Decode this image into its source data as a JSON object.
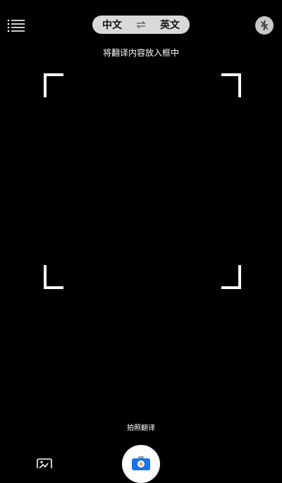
{
  "header": {
    "menu_icon": "list-menu-icon",
    "source_lang": "中文",
    "target_lang": "英文",
    "swap_icon": "swap-arrows-icon",
    "flash_icon": "flash-off-icon"
  },
  "viewfinder": {
    "hint": "将翻译内容放入框中"
  },
  "footer": {
    "mode_label": "拍照翻译",
    "gallery_icon": "image-gallery-icon",
    "shutter_icon": "camera-shutter-icon"
  },
  "colors": {
    "background": "#000000",
    "pill": "#d9d9d9",
    "accent_blue": "#1a73e8",
    "shutter": "#ffffff"
  }
}
